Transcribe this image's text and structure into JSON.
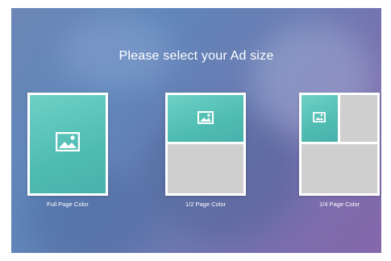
{
  "title": "Please select your Ad size",
  "options": [
    {
      "label": "Full Page Color"
    },
    {
      "label": "1/2 Page Color"
    },
    {
      "label": "1/4 Page Color"
    }
  ],
  "icons": {
    "image": "image-icon"
  },
  "colors": {
    "background_start": "#6c86b6",
    "background_end": "#8467ab",
    "teal": "#4fbcb3",
    "placeholder_gray": "#cfcfcf",
    "card_border": "#ffffff",
    "text": "#ffffff"
  }
}
